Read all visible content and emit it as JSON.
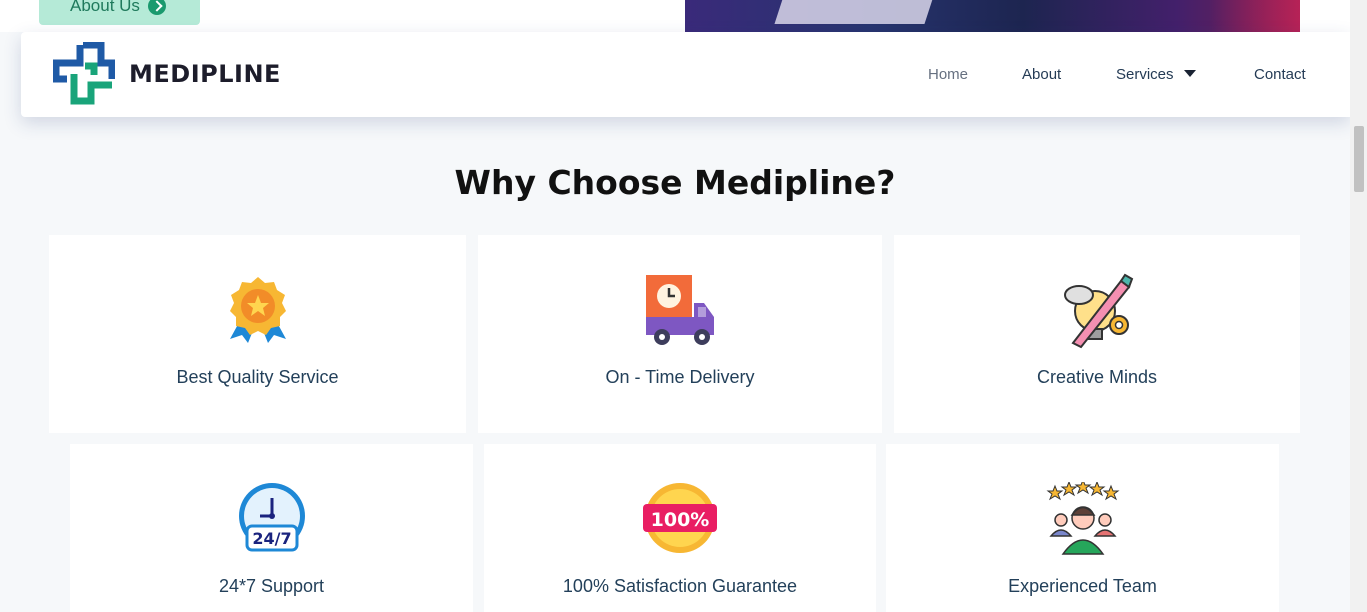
{
  "hero": {
    "about_label": "About Us"
  },
  "brand": {
    "name": "MEDIPLINE",
    "colors": {
      "blue": "#1f5aa6",
      "green": "#19a47a"
    }
  },
  "nav": {
    "items": [
      {
        "label": "Home"
      },
      {
        "label": "About"
      },
      {
        "label": "Services"
      },
      {
        "label": "Contact"
      }
    ]
  },
  "section": {
    "title": "Why Choose Medipline?",
    "features": [
      {
        "label": "Best Quality Service",
        "icon": "medal-icon"
      },
      {
        "label": "On - Time Delivery",
        "icon": "delivery-truck-icon"
      },
      {
        "label": "Creative Minds",
        "icon": "creative-bulb-icon"
      },
      {
        "label": "24*7 Support",
        "icon": "clock-24-7-icon"
      },
      {
        "label": "100% Satisfaction Guarantee",
        "icon": "hundred-percent-icon"
      },
      {
        "label": "Experienced Team",
        "icon": "team-stars-icon"
      }
    ]
  }
}
